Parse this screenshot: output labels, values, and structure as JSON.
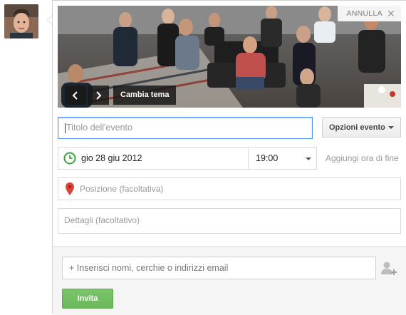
{
  "theme": {
    "cancel_label": "ANNULLA",
    "change_theme_label": "Cambia tema",
    "prev_icon": "chevron-left-icon",
    "next_icon": "chevron-right-icon"
  },
  "form": {
    "title_placeholder": "Titolo dell'evento",
    "options_button": "Opzioni evento",
    "date_value": "gio 28 giu 2012",
    "time_value": "19:00",
    "add_end_time": "Aggiungi ora di fine",
    "location_placeholder": "Posizione (facoltativa)",
    "details_placeholder": "Dettagli (facoltativo)"
  },
  "invite": {
    "input_placeholder": "+ Inserisci nomi, cerchie o indirizzi email",
    "button_label": "Invita"
  },
  "colors": {
    "focus_border": "#4d90fe",
    "invite_green": "#6bb85a",
    "clock_green": "#3ea63a",
    "pin_red": "#db4437"
  }
}
